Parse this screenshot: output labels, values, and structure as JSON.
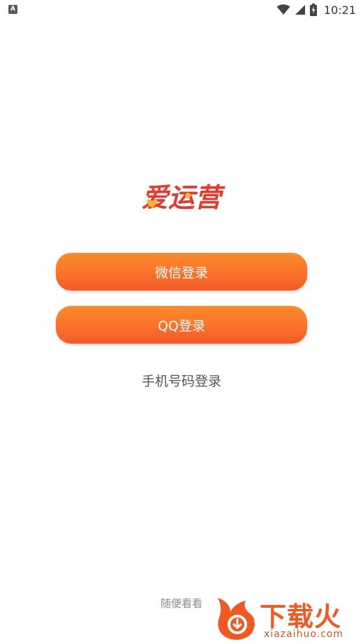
{
  "status_bar": {
    "left_icon": "A",
    "time": "10:21",
    "icons": [
      "notification-a-icon",
      "wifi-icon",
      "signal-icon",
      "battery-charging-icon"
    ]
  },
  "logo": {
    "text": "爱运营",
    "primary_color": "#e8382e",
    "heart_color": "#f7b733"
  },
  "buttons": {
    "wechat_label": "微信登录",
    "qq_label": "QQ登录"
  },
  "phone_login_label": "手机号码登录",
  "browse_label": "随便看看",
  "watermark": {
    "cn": "下载火",
    "en": "xiazaihuo.com"
  },
  "colors": {
    "button_gradient_top": "#fb8c2a",
    "button_gradient_bottom": "#f35a27",
    "watermark": "#f05a22"
  }
}
